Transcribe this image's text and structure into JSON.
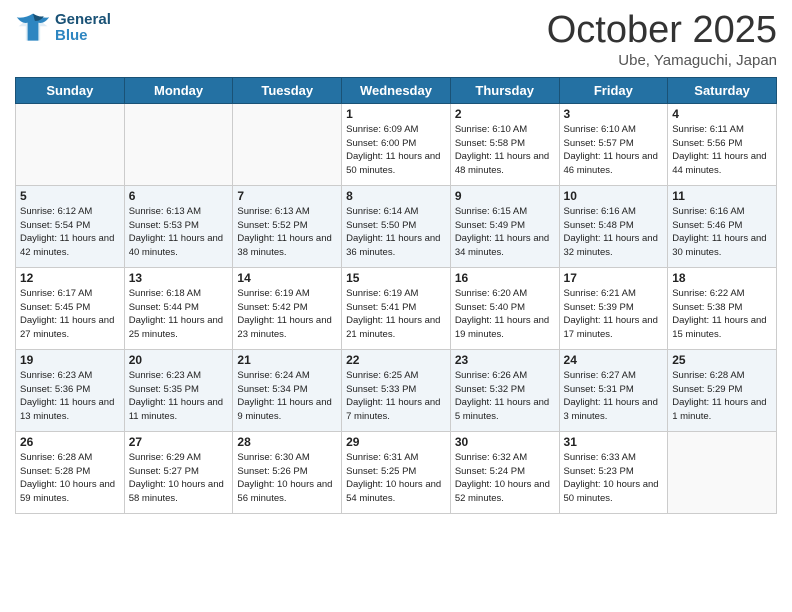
{
  "header": {
    "logo_general": "General",
    "logo_blue": "Blue",
    "month": "October 2025",
    "location": "Ube, Yamaguchi, Japan"
  },
  "weekdays": [
    "Sunday",
    "Monday",
    "Tuesday",
    "Wednesday",
    "Thursday",
    "Friday",
    "Saturday"
  ],
  "weeks": [
    [
      {
        "day": "",
        "info": ""
      },
      {
        "day": "",
        "info": ""
      },
      {
        "day": "",
        "info": ""
      },
      {
        "day": "1",
        "info": "Sunrise: 6:09 AM\nSunset: 6:00 PM\nDaylight: 11 hours and 50 minutes."
      },
      {
        "day": "2",
        "info": "Sunrise: 6:10 AM\nSunset: 5:58 PM\nDaylight: 11 hours and 48 minutes."
      },
      {
        "day": "3",
        "info": "Sunrise: 6:10 AM\nSunset: 5:57 PM\nDaylight: 11 hours and 46 minutes."
      },
      {
        "day": "4",
        "info": "Sunrise: 6:11 AM\nSunset: 5:56 PM\nDaylight: 11 hours and 44 minutes."
      }
    ],
    [
      {
        "day": "5",
        "info": "Sunrise: 6:12 AM\nSunset: 5:54 PM\nDaylight: 11 hours and 42 minutes."
      },
      {
        "day": "6",
        "info": "Sunrise: 6:13 AM\nSunset: 5:53 PM\nDaylight: 11 hours and 40 minutes."
      },
      {
        "day": "7",
        "info": "Sunrise: 6:13 AM\nSunset: 5:52 PM\nDaylight: 11 hours and 38 minutes."
      },
      {
        "day": "8",
        "info": "Sunrise: 6:14 AM\nSunset: 5:50 PM\nDaylight: 11 hours and 36 minutes."
      },
      {
        "day": "9",
        "info": "Sunrise: 6:15 AM\nSunset: 5:49 PM\nDaylight: 11 hours and 34 minutes."
      },
      {
        "day": "10",
        "info": "Sunrise: 6:16 AM\nSunset: 5:48 PM\nDaylight: 11 hours and 32 minutes."
      },
      {
        "day": "11",
        "info": "Sunrise: 6:16 AM\nSunset: 5:46 PM\nDaylight: 11 hours and 30 minutes."
      }
    ],
    [
      {
        "day": "12",
        "info": "Sunrise: 6:17 AM\nSunset: 5:45 PM\nDaylight: 11 hours and 27 minutes."
      },
      {
        "day": "13",
        "info": "Sunrise: 6:18 AM\nSunset: 5:44 PM\nDaylight: 11 hours and 25 minutes."
      },
      {
        "day": "14",
        "info": "Sunrise: 6:19 AM\nSunset: 5:42 PM\nDaylight: 11 hours and 23 minutes."
      },
      {
        "day": "15",
        "info": "Sunrise: 6:19 AM\nSunset: 5:41 PM\nDaylight: 11 hours and 21 minutes."
      },
      {
        "day": "16",
        "info": "Sunrise: 6:20 AM\nSunset: 5:40 PM\nDaylight: 11 hours and 19 minutes."
      },
      {
        "day": "17",
        "info": "Sunrise: 6:21 AM\nSunset: 5:39 PM\nDaylight: 11 hours and 17 minutes."
      },
      {
        "day": "18",
        "info": "Sunrise: 6:22 AM\nSunset: 5:38 PM\nDaylight: 11 hours and 15 minutes."
      }
    ],
    [
      {
        "day": "19",
        "info": "Sunrise: 6:23 AM\nSunset: 5:36 PM\nDaylight: 11 hours and 13 minutes."
      },
      {
        "day": "20",
        "info": "Sunrise: 6:23 AM\nSunset: 5:35 PM\nDaylight: 11 hours and 11 minutes."
      },
      {
        "day": "21",
        "info": "Sunrise: 6:24 AM\nSunset: 5:34 PM\nDaylight: 11 hours and 9 minutes."
      },
      {
        "day": "22",
        "info": "Sunrise: 6:25 AM\nSunset: 5:33 PM\nDaylight: 11 hours and 7 minutes."
      },
      {
        "day": "23",
        "info": "Sunrise: 6:26 AM\nSunset: 5:32 PM\nDaylight: 11 hours and 5 minutes."
      },
      {
        "day": "24",
        "info": "Sunrise: 6:27 AM\nSunset: 5:31 PM\nDaylight: 11 hours and 3 minutes."
      },
      {
        "day": "25",
        "info": "Sunrise: 6:28 AM\nSunset: 5:29 PM\nDaylight: 11 hours and 1 minute."
      }
    ],
    [
      {
        "day": "26",
        "info": "Sunrise: 6:28 AM\nSunset: 5:28 PM\nDaylight: 10 hours and 59 minutes."
      },
      {
        "day": "27",
        "info": "Sunrise: 6:29 AM\nSunset: 5:27 PM\nDaylight: 10 hours and 58 minutes."
      },
      {
        "day": "28",
        "info": "Sunrise: 6:30 AM\nSunset: 5:26 PM\nDaylight: 10 hours and 56 minutes."
      },
      {
        "day": "29",
        "info": "Sunrise: 6:31 AM\nSunset: 5:25 PM\nDaylight: 10 hours and 54 minutes."
      },
      {
        "day": "30",
        "info": "Sunrise: 6:32 AM\nSunset: 5:24 PM\nDaylight: 10 hours and 52 minutes."
      },
      {
        "day": "31",
        "info": "Sunrise: 6:33 AM\nSunset: 5:23 PM\nDaylight: 10 hours and 50 minutes."
      },
      {
        "day": "",
        "info": ""
      }
    ]
  ]
}
